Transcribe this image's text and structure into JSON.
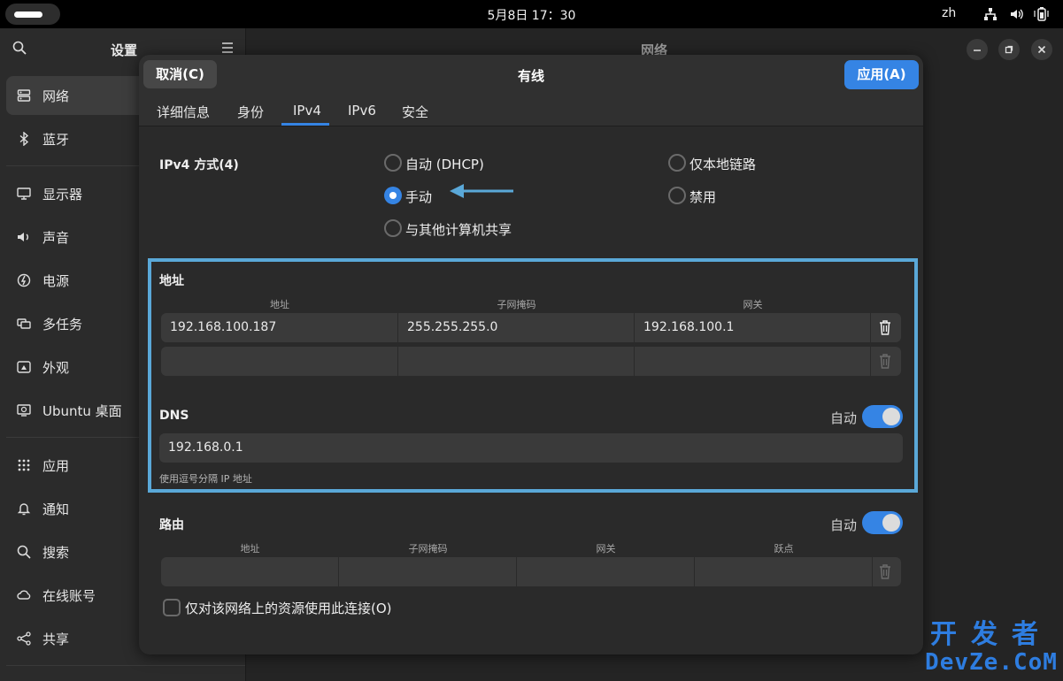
{
  "topbar": {
    "clock": "5月8日 17：30",
    "lang": "zh"
  },
  "sidebar": {
    "title": "设置",
    "items": [
      {
        "label": "网络",
        "icon": "network-icon"
      },
      {
        "label": "蓝牙",
        "icon": "bluetooth-icon"
      },
      {
        "label": "显示器",
        "icon": "display-icon"
      },
      {
        "label": "声音",
        "icon": "sound-icon"
      },
      {
        "label": "电源",
        "icon": "power-icon"
      },
      {
        "label": "多任务",
        "icon": "multitasking-icon"
      },
      {
        "label": "外观",
        "icon": "appearance-icon"
      },
      {
        "label": "Ubuntu 桌面",
        "icon": "ubuntu-desktop-icon"
      },
      {
        "label": "应用",
        "icon": "apps-icon"
      },
      {
        "label": "通知",
        "icon": "bell-icon"
      },
      {
        "label": "搜索",
        "icon": "search-icon"
      },
      {
        "label": "在线账号",
        "icon": "online-accounts-icon"
      },
      {
        "label": "共享",
        "icon": "share-icon"
      }
    ]
  },
  "content": {
    "title": "网络"
  },
  "dialog": {
    "cancel": "取消(C)",
    "title": "有线",
    "apply": "应用(A)",
    "tabs": [
      "详细信息",
      "身份",
      "IPv4",
      "IPv6",
      "安全"
    ],
    "method": {
      "label": "IPv4 方式(4)",
      "options": [
        "自动 (DHCP)",
        "手动",
        "与其他计算机共享",
        "仅本地链路",
        "禁用"
      ]
    },
    "address": {
      "title": "地址",
      "headers": [
        "地址",
        "子网掩码",
        "网关"
      ],
      "rows": [
        [
          "192.168.100.187",
          "255.255.255.0",
          "192.168.100.1"
        ],
        [
          "",
          "",
          ""
        ]
      ]
    },
    "dns": {
      "title": "DNS",
      "auto": "自动",
      "value": "192.168.0.1",
      "hint": "使用逗号分隔 IP 地址"
    },
    "routes": {
      "title": "路由",
      "auto": "自动",
      "headers": [
        "地址",
        "子网掩码",
        "网关",
        "跃点"
      ]
    },
    "checkbox": "仅对该网络上的资源使用此连接(O)"
  },
  "watermark": {
    "line1": "开发者",
    "line2": "DevZe.CoM"
  },
  "colors": {
    "accent": "#3584e4",
    "highlight": "#5aa8d8",
    "arrow": "#5aa8d8"
  }
}
